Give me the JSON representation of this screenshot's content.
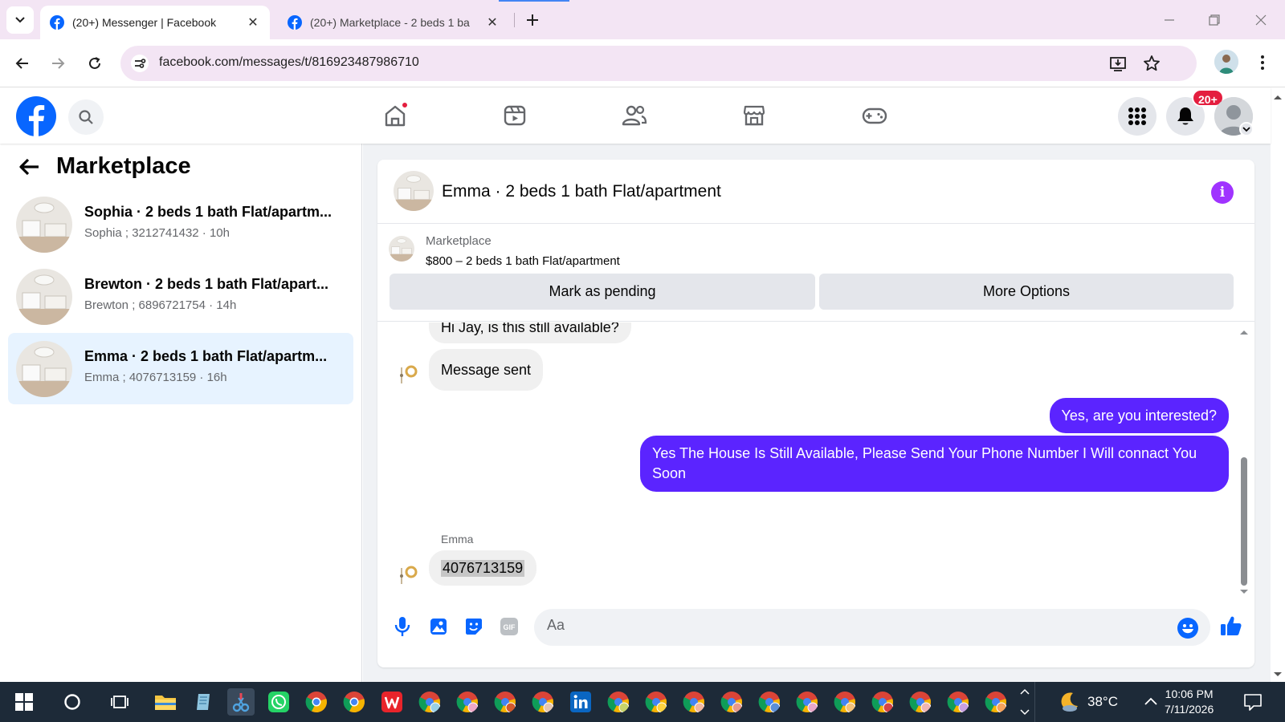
{
  "browser": {
    "tabs": [
      {
        "title": "(20+) Messenger | Facebook",
        "active": true
      },
      {
        "title": "(20+) Marketplace - 2 beds 1 ba",
        "active": false
      }
    ],
    "url": "facebook.com/messages/t/816923487986710",
    "accent": "#4285f4",
    "frame_color": "#f3e5f4"
  },
  "fb_nav": {
    "notification_badge": "20+",
    "icons": [
      "home-icon",
      "reels-icon",
      "friends-icon",
      "marketplace-icon",
      "gaming-icon"
    ],
    "brand_color": "#0866ff"
  },
  "sidebar": {
    "title": "Marketplace",
    "conversations": [
      {
        "name": "Sophia · 2 beds 1 bath Flat/apartm...",
        "meta": "Sophia ; 3212741432 · 10h",
        "active": false
      },
      {
        "name": "Brewton · 2 beds 1 bath Flat/apart...",
        "meta": "Brewton ; 6896721754 · 14h",
        "active": false
      },
      {
        "name": "Emma · 2 beds 1 bath Flat/apartm...",
        "meta": "Emma ; 4076713159 · 16h",
        "active": true
      }
    ]
  },
  "chat": {
    "title": "Emma · 2 beds 1 bath Flat/apartment",
    "listing_source": "Marketplace",
    "listing_price": "$800 – 2 beds 1 bath Flat/apartment",
    "mark_pending_label": "Mark as pending",
    "more_options_label": "More Options",
    "messages": [
      {
        "from": "them",
        "text": "Hi Jay, is this still available?"
      },
      {
        "from": "them",
        "text": "Message sent"
      },
      {
        "from": "me",
        "text": "Yes, are you interested?"
      },
      {
        "from": "me",
        "text": "Yes The House Is Still Available, Please Send Your Phone Number I Will connact You Soon"
      },
      {
        "from": "them",
        "sender": "Emma",
        "text": "4076713159"
      }
    ],
    "composer_placeholder": "Aa",
    "outgoing_color": "#5b24ff"
  },
  "taskbar": {
    "temperature": "38°C",
    "time": "10:06 PM",
    "date": "7/11/2026"
  }
}
